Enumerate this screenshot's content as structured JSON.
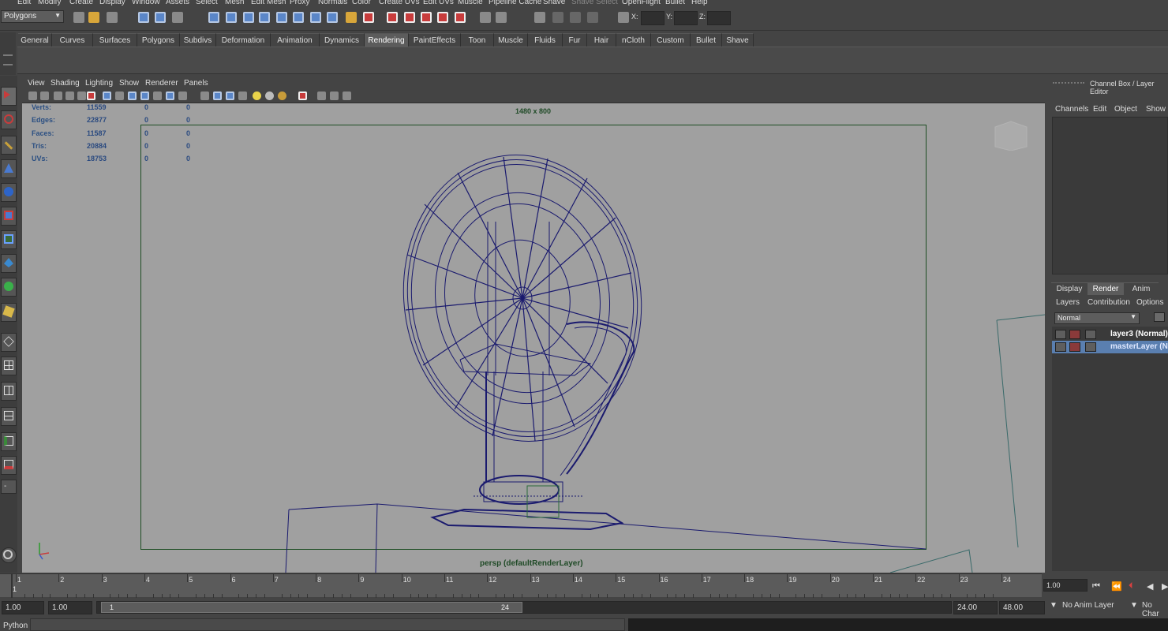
{
  "menubar": [
    "Edit",
    "Modify",
    "Create",
    "Display",
    "Window",
    "Assets",
    "Select",
    "Mesh",
    "Edit Mesh",
    "Proxy",
    "Normals",
    "Color",
    "Create UVs",
    "Edit UVs",
    "Muscle",
    "Pipeline Cache",
    "Shave",
    "Shave Select",
    "OpenFlight",
    "Bullet",
    "Help"
  ],
  "status": {
    "mode": "Polygons",
    "x_label": "X:",
    "y_label": "Y:",
    "z_label": "Z:"
  },
  "shelf_tabs": [
    "General",
    "Curves",
    "Surfaces",
    "Polygons",
    "Subdivs",
    "Deformation",
    "Animation",
    "Dynamics",
    "Rendering",
    "PaintEffects",
    "Toon",
    "Muscle",
    "Fluids",
    "Fur",
    "Hair",
    "nCloth",
    "Custom",
    "Bullet",
    "Shave"
  ],
  "shelf_active": "Rendering",
  "viewport_menu": [
    "View",
    "Shading",
    "Lighting",
    "Show",
    "Renderer",
    "Panels"
  ],
  "hud": {
    "rows": [
      {
        "label": "Verts:",
        "v1": "11559",
        "v2": "0",
        "v3": "0"
      },
      {
        "label": "Edges:",
        "v1": "22877",
        "v2": "0",
        "v3": "0"
      },
      {
        "label": "Faces:",
        "v1": "11587",
        "v2": "0",
        "v3": "0"
      },
      {
        "label": "Tris:",
        "v1": "20884",
        "v2": "0",
        "v3": "0"
      },
      {
        "label": "UVs:",
        "v1": "18753",
        "v2": "0",
        "v3": "0"
      }
    ],
    "resolution": "1480 x 800",
    "camera": "persp (defaultRenderLayer)"
  },
  "channel_box": {
    "title": "Channel Box / Layer Editor",
    "menu": [
      "Channels",
      "Edit",
      "Object",
      "Show"
    ]
  },
  "layer_editor": {
    "tabs": [
      "Display",
      "Render",
      "Anim"
    ],
    "active_tab": "Render",
    "menu": [
      "Layers",
      "Contribution",
      "Options"
    ],
    "blend_mode": "Normal",
    "layers": [
      {
        "name": "layer3 (Normal)",
        "selected": false
      },
      {
        "name": "masterLayer (N",
        "selected": true
      }
    ]
  },
  "time_slider": {
    "ticks": [
      "1",
      "2",
      "3",
      "4",
      "5",
      "6",
      "7",
      "8",
      "9",
      "10",
      "11",
      "12",
      "13",
      "14",
      "15",
      "16",
      "17",
      "18",
      "19",
      "20",
      "21",
      "22",
      "23",
      "24"
    ],
    "current_marker": "1",
    "current_frame": "1.00"
  },
  "range": {
    "start": "1.00",
    "anim_start": "1.00",
    "range_start": "1",
    "range_end": "24",
    "anim_end_field": "24.00",
    "end_field": "48.00",
    "anim_layer": "No Anim Layer",
    "char_set": "No Char"
  },
  "command_line": {
    "label": "Python"
  },
  "colors": {
    "wire": "#1a1a6e",
    "viewport_bg": "#a0a0a0",
    "gate": "#1e4e24",
    "selection": "#5a7fb0"
  }
}
